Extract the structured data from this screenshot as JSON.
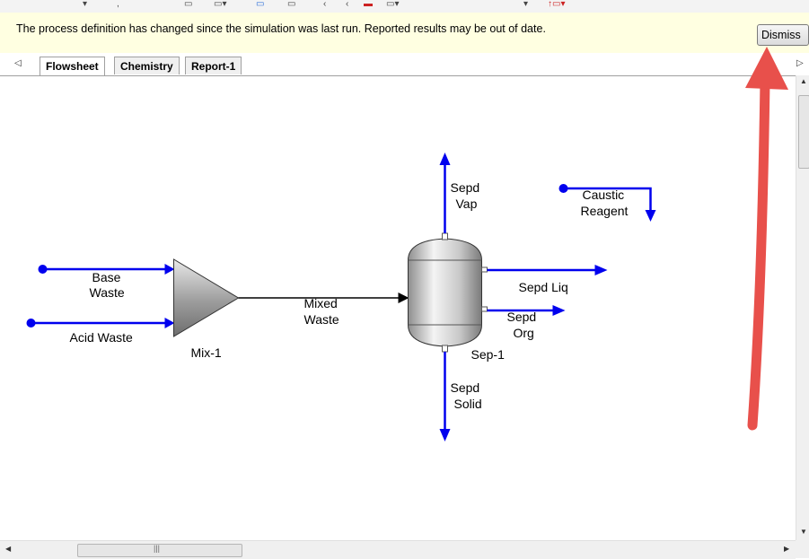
{
  "info_bar": {
    "message": "The process definition has changed since the simulation was last run. Reported results may be out of date.",
    "dismiss_label": "Dismiss"
  },
  "tabs": [
    {
      "label": "Flowsheet",
      "active": true
    },
    {
      "label": "Chemistry",
      "active": false
    },
    {
      "label": "Report-1",
      "active": false
    }
  ],
  "flowsheet": {
    "units": {
      "mixer": "Mix-1",
      "separator": "Sep-1"
    },
    "streams": {
      "base_waste": [
        "Base",
        "Waste"
      ],
      "acid_waste": "Acid Waste",
      "mixed_waste": [
        "Mixed",
        "Waste"
      ],
      "sepd_vap": [
        "Sepd",
        "Vap"
      ],
      "sepd_liq": "Sepd Liq",
      "sepd_org": [
        "Sepd",
        "Org"
      ],
      "sepd_solid": [
        "Sepd",
        "Solid"
      ],
      "caustic_reagent": [
        "Caustic",
        "Reagent"
      ]
    }
  },
  "colors": {
    "stream_blue": "#0000ee",
    "annotation_arrow": "#e8504b",
    "info_bar_bg": "#ffffe1"
  },
  "icons": {
    "tab_scroll_left": "triangle-left-icon",
    "tab_scroll_right": "triangle-right-icon",
    "hscroll_grip": "grip-icon"
  }
}
